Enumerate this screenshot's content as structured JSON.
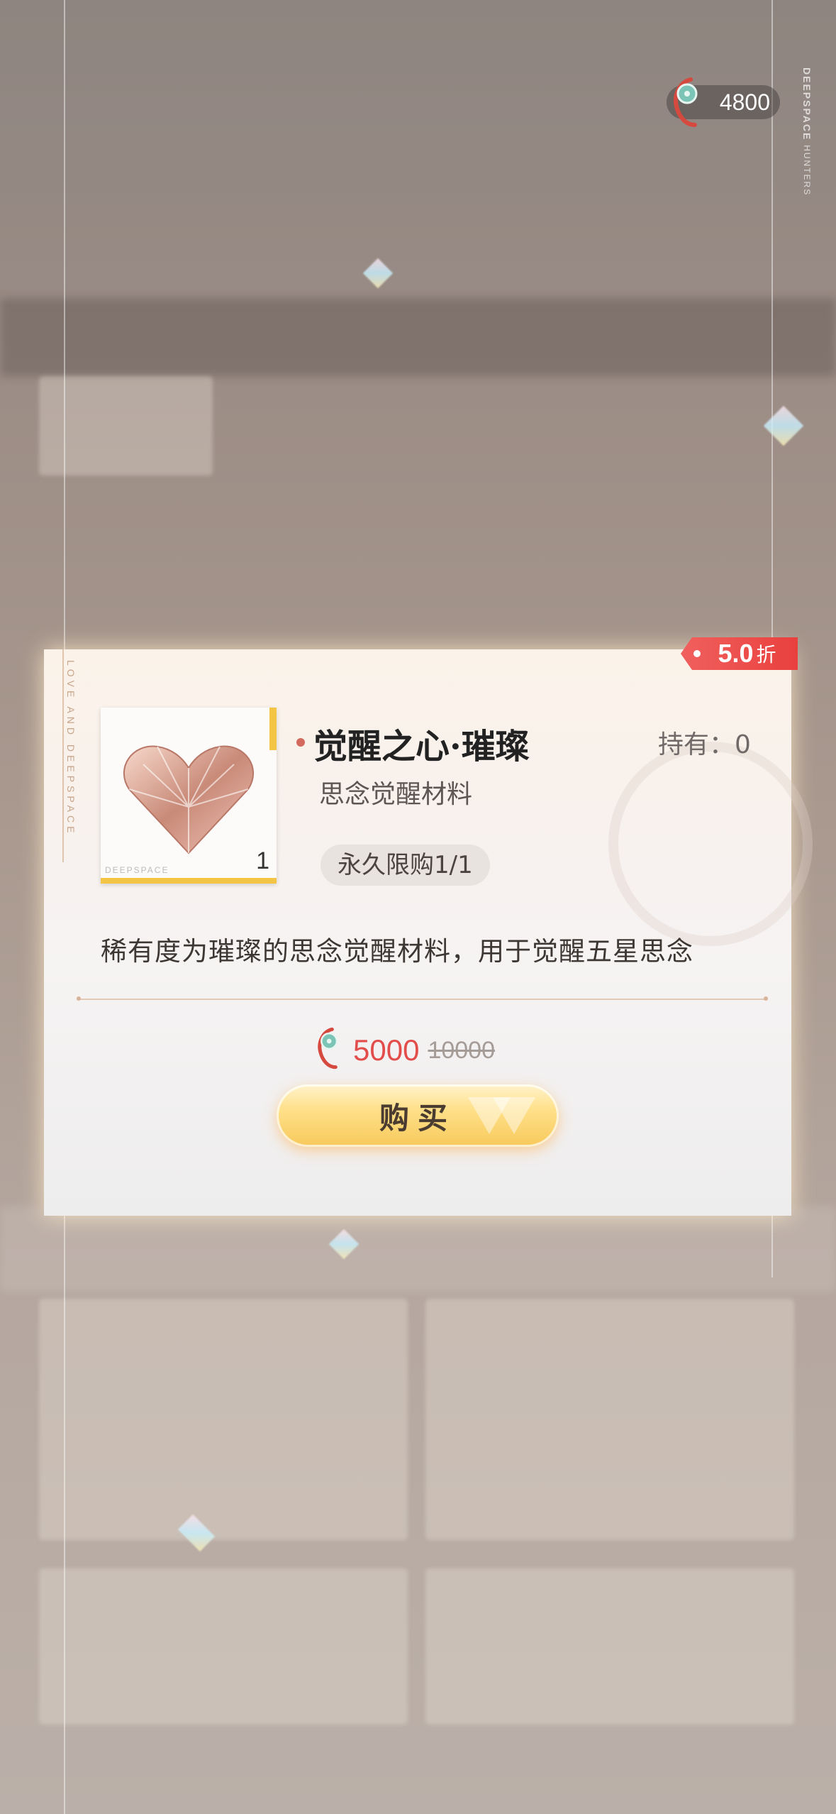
{
  "currency": {
    "amount": "4800"
  },
  "brand": {
    "logo_main": "DEEPSPACE",
    "logo_sub": "HUNTERS"
  },
  "modal": {
    "side_label": "LOVE AND DEEPSPACE",
    "discount": {
      "value": "5.0",
      "unit": "折"
    },
    "item": {
      "name": "觉醒之心·璀璨",
      "category": "思念觉醒材料",
      "owned": "持有：0",
      "quantity": "1",
      "icon_brand": "DEEPSPACE",
      "purchase_limit": "永久限购1/1",
      "description": "稀有度为璀璨的思念觉醒材料，用于觉醒五星思念"
    },
    "price": {
      "current": "5000",
      "original": "10000"
    },
    "buy_label": "购买"
  },
  "colors": {
    "accent_red": "#e24d4b",
    "gold": "#f4c544"
  }
}
